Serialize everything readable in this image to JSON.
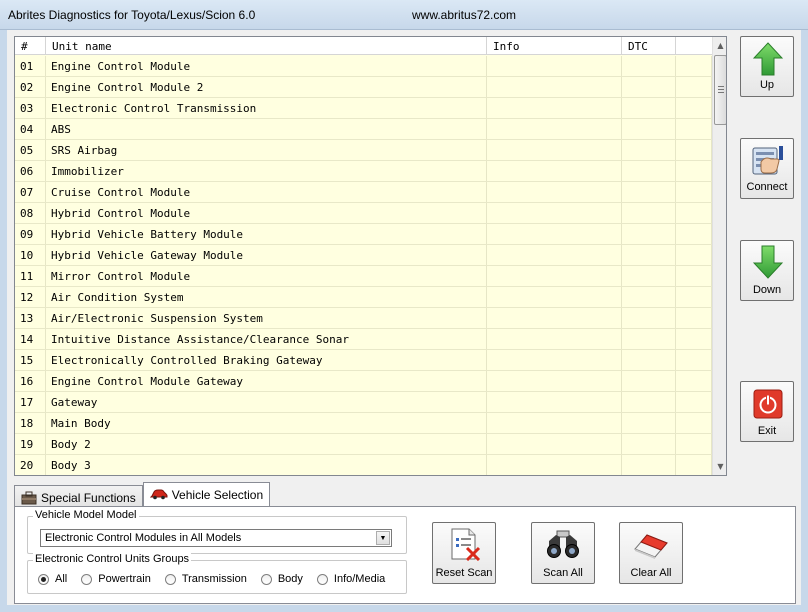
{
  "window": {
    "title": "Abrites Diagnostics for Toyota/Lexus/Scion 6.0",
    "url": "www.abritus72.com"
  },
  "table": {
    "columns": [
      "#",
      "Unit name",
      "Info",
      "DTC"
    ],
    "rows": [
      {
        "num": "01",
        "name": "Engine Control Module"
      },
      {
        "num": "02",
        "name": "Engine Control Module 2"
      },
      {
        "num": "03",
        "name": "Electronic Control Transmission"
      },
      {
        "num": "04",
        "name": "ABS"
      },
      {
        "num": "05",
        "name": "SRS Airbag"
      },
      {
        "num": "06",
        "name": "Immobilizer"
      },
      {
        "num": "07",
        "name": "Cruise Control Module"
      },
      {
        "num": "08",
        "name": "Hybrid Control Module"
      },
      {
        "num": "09",
        "name": "Hybrid Vehicle Battery Module"
      },
      {
        "num": "10",
        "name": "Hybrid Vehicle Gateway Module"
      },
      {
        "num": "11",
        "name": "Mirror Control Module"
      },
      {
        "num": "12",
        "name": "Air Condition System"
      },
      {
        "num": "13",
        "name": "Air/Electronic Suspension System"
      },
      {
        "num": "14",
        "name": "Intuitive Distance Assistance/Clearance Sonar"
      },
      {
        "num": "15",
        "name": "Electronically Controlled Braking Gateway"
      },
      {
        "num": "16",
        "name": "Engine Control Module Gateway"
      },
      {
        "num": "17",
        "name": "Gateway"
      },
      {
        "num": "18",
        "name": "Main Body"
      },
      {
        "num": "19",
        "name": "Body 2"
      },
      {
        "num": "20",
        "name": "Body 3"
      }
    ]
  },
  "side_buttons": {
    "up": "Up",
    "connect": "Connect",
    "down": "Down",
    "exit": "Exit"
  },
  "tabs": {
    "special": "Special Functions",
    "vehicle": "Vehicle Selection"
  },
  "vehicle_model": {
    "legend": "Vehicle Model Model",
    "selected": "Electronic Control Modules in All Models"
  },
  "ecu_groups": {
    "legend": "Electronic Control Units Groups",
    "options": [
      "All",
      "Powertrain",
      "Transmission",
      "Body",
      "Info/Media"
    ],
    "selected": "All"
  },
  "panel_buttons": {
    "reset_scan": "Reset Scan",
    "scan_all": "Scan All",
    "clear_all": "Clear All"
  },
  "colors": {
    "row_bg": "#ffffe0",
    "arrow_green": "#3cb24a",
    "exit_red": "#e03a2a"
  }
}
